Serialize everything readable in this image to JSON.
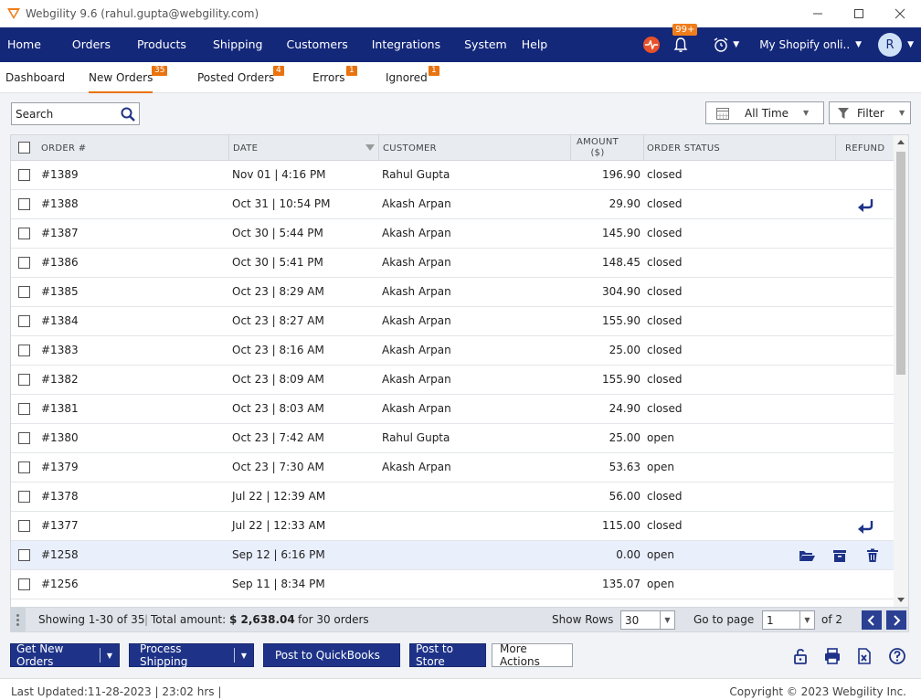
{
  "window": {
    "title": "Webgility 9.6 (rahul.gupta@webgility.com)"
  },
  "nav": {
    "items": [
      "Home",
      "Orders",
      "Products",
      "Shipping",
      "Customers",
      "Integrations",
      "System",
      "Help"
    ],
    "notification_badge": "99+",
    "store": "My Shopify onli..",
    "avatar": "R"
  },
  "tabs": [
    {
      "label": "Dashboard",
      "badge": ""
    },
    {
      "label": "New Orders",
      "badge": "35"
    },
    {
      "label": "Posted Orders",
      "badge": "4"
    },
    {
      "label": "Errors",
      "badge": "1"
    },
    {
      "label": "Ignored",
      "badge": "1"
    }
  ],
  "toolbar": {
    "search_placeholder": "Search",
    "date_filter": "All Time",
    "filter_label": "Filter"
  },
  "grid": {
    "columns": {
      "order": "ORDER #",
      "date": "DATE",
      "customer": "CUSTOMER",
      "amount": "AMOUNT ($)",
      "status": "ORDER STATUS",
      "refund": "REFUND"
    },
    "rows": [
      {
        "order": "#1389",
        "date": "Nov 01 | 4:16 PM",
        "customer": "Rahul Gupta",
        "amount": "196.90",
        "status": "closed"
      },
      {
        "order": "#1388",
        "date": "Oct 31 | 10:54 PM",
        "customer": "Akash Arpan",
        "amount": "29.90",
        "status": "closed"
      },
      {
        "order": "#1387",
        "date": "Oct 30 | 5:44 PM",
        "customer": "Akash Arpan",
        "amount": "145.90",
        "status": "closed"
      },
      {
        "order": "#1386",
        "date": "Oct 30 | 5:41 PM",
        "customer": "Akash Arpan",
        "amount": "148.45",
        "status": "closed"
      },
      {
        "order": "#1385",
        "date": "Oct 23 | 8:29 AM",
        "customer": "Akash Arpan",
        "amount": "304.90",
        "status": "closed"
      },
      {
        "order": "#1384",
        "date": "Oct 23 | 8:27 AM",
        "customer": "Akash Arpan",
        "amount": "155.90",
        "status": "closed"
      },
      {
        "order": "#1383",
        "date": "Oct 23 | 8:16 AM",
        "customer": "Akash Arpan",
        "amount": "25.00",
        "status": "closed"
      },
      {
        "order": "#1382",
        "date": "Oct 23 | 8:09 AM",
        "customer": "Akash Arpan",
        "amount": "155.90",
        "status": "closed"
      },
      {
        "order": "#1381",
        "date": "Oct 23 | 8:03 AM",
        "customer": "Akash Arpan",
        "amount": "24.90",
        "status": "closed"
      },
      {
        "order": "#1380",
        "date": "Oct 23 | 7:42 AM",
        "customer": "Rahul Gupta",
        "amount": "25.00",
        "status": "open"
      },
      {
        "order": "#1379",
        "date": "Oct 23 | 7:30 AM",
        "customer": "Akash Arpan",
        "amount": "53.63",
        "status": "open"
      },
      {
        "order": "#1378",
        "date": "Jul 22 | 12:39 AM",
        "customer": "",
        "amount": "56.00",
        "status": "closed"
      },
      {
        "order": "#1377",
        "date": "Jul 22 | 12:33 AM",
        "customer": "",
        "amount": "115.00",
        "status": "closed"
      },
      {
        "order": "#1258",
        "date": "Sep 12 | 6:16 PM",
        "customer": "",
        "amount": "0.00",
        "status": "open"
      },
      {
        "order": "#1256",
        "date": "Sep 11 | 8:34 PM",
        "customer": "",
        "amount": "135.07",
        "status": "open"
      }
    ]
  },
  "footer": {
    "showing": "Showing 1-30 of 35",
    "total_label": "Total amount:",
    "total_value": "$ 2,638.04",
    "for_orders": "for 30 orders",
    "show_rows_label": "Show Rows",
    "show_rows_value": "30",
    "goto_label": "Go to page",
    "goto_value": "1",
    "of_pages": "of 2"
  },
  "actions": {
    "get_new_orders": "Get New Orders",
    "process_shipping": "Process Shipping",
    "post_quickbooks": "Post to QuickBooks",
    "post_store": "Post to Store",
    "more_actions": "More Actions"
  },
  "status": {
    "last_updated": "Last Updated:11-28-2023 | 23:02 hrs |",
    "copyright": "Copyright © 2023 Webgility Inc."
  },
  "colors": {
    "nav_bg": "#14287a",
    "accent_orange": "#e8730f",
    "button_blue": "#1e3388"
  }
}
